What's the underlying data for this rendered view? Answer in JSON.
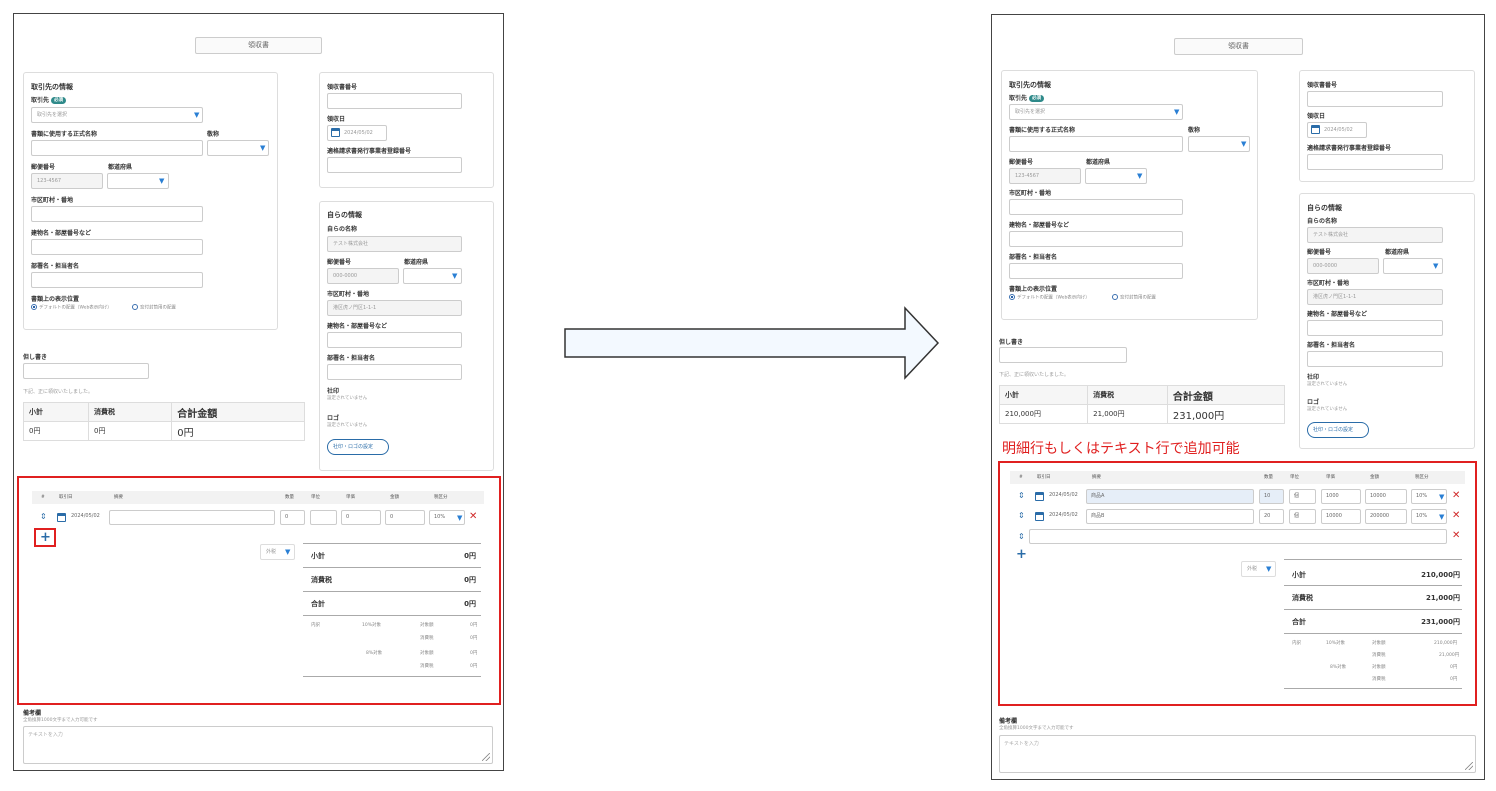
{
  "doc_title": "領収書",
  "client": {
    "heading": "取引先の情報",
    "client_label": "取引先",
    "required": "必須",
    "client_placeholder": "取引先を選択",
    "official_name_label": "書類に使用する正式名称",
    "honorific_label": "敬称",
    "postal_label": "郵便番号",
    "pref_label": "都道府県",
    "postal_placeholder": "123-4567",
    "city_label": "市区町村・番地",
    "building_label": "建物名・部屋番号など",
    "dept_label": "部署名・担当者名",
    "display_pos_label": "書類上の表示位置",
    "radio_default": "デフォルトの配置（Web表示向け）",
    "radio_window": "窓付封筒用の配置"
  },
  "receipt": {
    "number_label": "領収書番号",
    "date_label": "領収日",
    "date_value": "2024/05/02",
    "invoice_reg_label": "適格請求書発行事業者登録番号"
  },
  "own": {
    "heading": "自らの情報",
    "name_label": "自らの名称",
    "name_value": "テスト株式会社",
    "postal_label": "郵便番号",
    "pref_label": "都道府県",
    "postal_value": "000-0000",
    "city_label": "市区町村・番地",
    "city_value": "港区虎ノ門区1-1-1",
    "building_label": "建物名・部屋番号など",
    "dept_label": "部署名・担当者名",
    "seal_label": "社印",
    "seal_status": "設定されていません",
    "logo_label": "ロゴ",
    "logo_status": "設定されていません",
    "setting_button": "社印・ロゴの設定"
  },
  "proviso_label": "但し書き",
  "received_text": "下記、正に領収いたしました。",
  "totals_headers": [
    "小計",
    "消費税",
    "合計金額"
  ],
  "totals_before": [
    "0円",
    "0円",
    "0円"
  ],
  "totals_after": [
    "210,000円",
    "21,000円",
    "231,000円"
  ],
  "item_headers": [
    "#",
    "取引日",
    "摘要",
    "数量",
    "単位",
    "単価",
    "金額",
    "税区分"
  ],
  "items_before": [
    {
      "date": "2024/05/02",
      "desc": "",
      "qty": "0",
      "unit": "",
      "price": "0",
      "amount": "0",
      "tax": "10%"
    }
  ],
  "items_after": [
    {
      "date": "2024/05/02",
      "desc": "商品A",
      "qty": "10",
      "unit": "個",
      "price": "1000",
      "amount": "10000",
      "tax": "10%"
    },
    {
      "date": "2024/05/02",
      "desc": "商品B",
      "qty": "20",
      "unit": "個",
      "price": "10000",
      "amount": "200000",
      "tax": "10%"
    }
  ],
  "tax_mode": "外税",
  "summary_labels": [
    "小計",
    "消費税",
    "合計"
  ],
  "summary_before": [
    "0円",
    "0円",
    "0円"
  ],
  "summary_after": [
    "210,000円",
    "21,000円",
    "231,000円"
  ],
  "breakdown": {
    "label": "内訳",
    "ten": "10%対象",
    "eight": "8%対象",
    "target": "対象額",
    "tax": "消費税"
  },
  "breakdown_before": [
    "0円",
    "0円",
    "0円",
    "0円"
  ],
  "breakdown_after": [
    "210,000円",
    "21,000円",
    "0円",
    "0円"
  ],
  "remarks": {
    "label": "備考欄",
    "hint": "全角換算1000文字まで入力可能です",
    "placeholder": "テキストを入力"
  },
  "annotation": "明細行もしくはテキスト行で追加可能"
}
